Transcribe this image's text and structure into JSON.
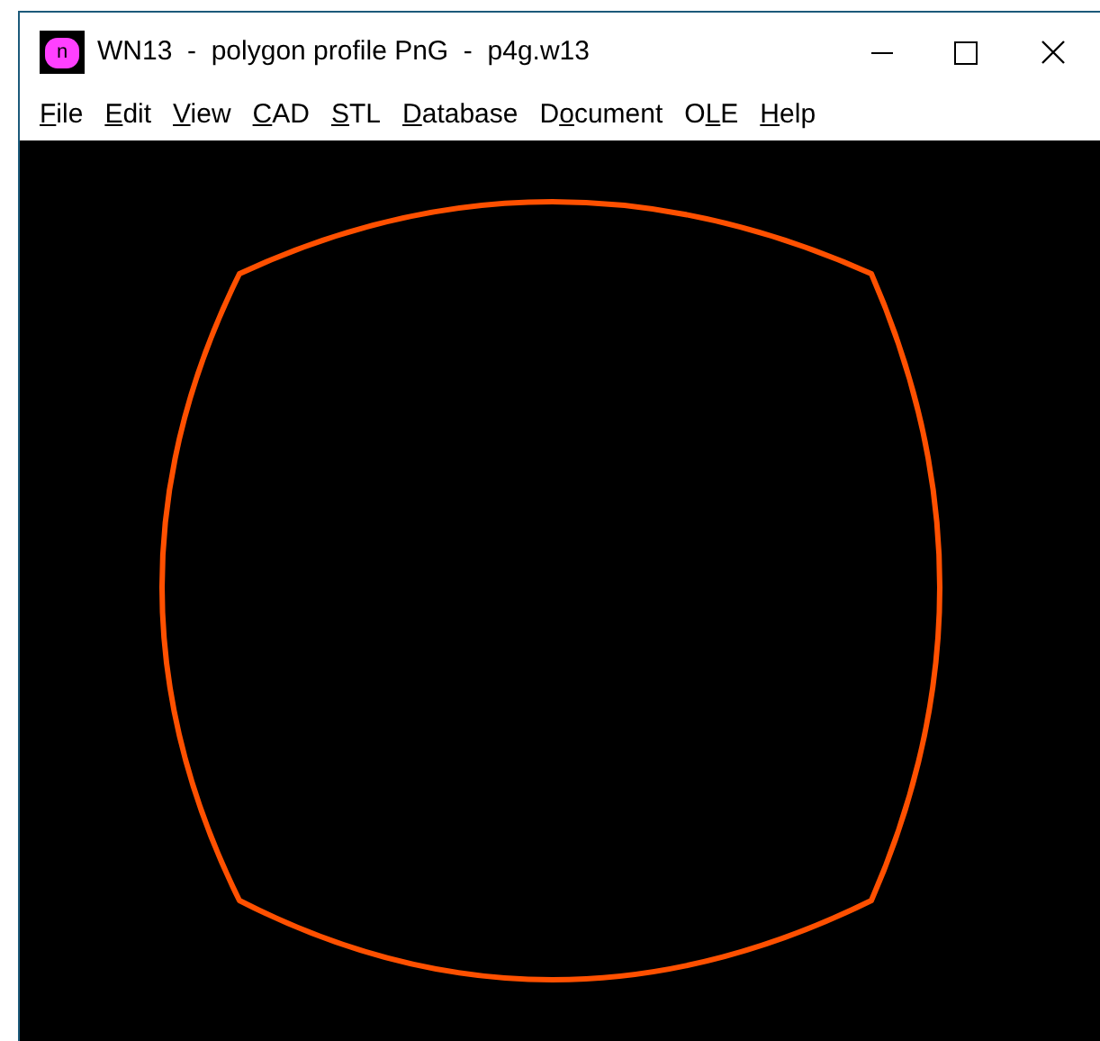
{
  "window": {
    "icon_letter": "n",
    "title": "WN13  -  polygon profile PnG  -  p4g.w13"
  },
  "menu": [
    {
      "key": "F",
      "after": "ile"
    },
    {
      "key": "E",
      "after": "dit"
    },
    {
      "key": "V",
      "after": "iew"
    },
    {
      "key": "C",
      "after": "AD"
    },
    {
      "key": "S",
      "after": "TL"
    },
    {
      "key": "D",
      "after": "atabase"
    },
    {
      "before": "D",
      "key": "o",
      "after": "cument"
    },
    {
      "before": "O",
      "key": "L",
      "after": "E"
    },
    {
      "key": "H",
      "after": "elp"
    }
  ]
}
